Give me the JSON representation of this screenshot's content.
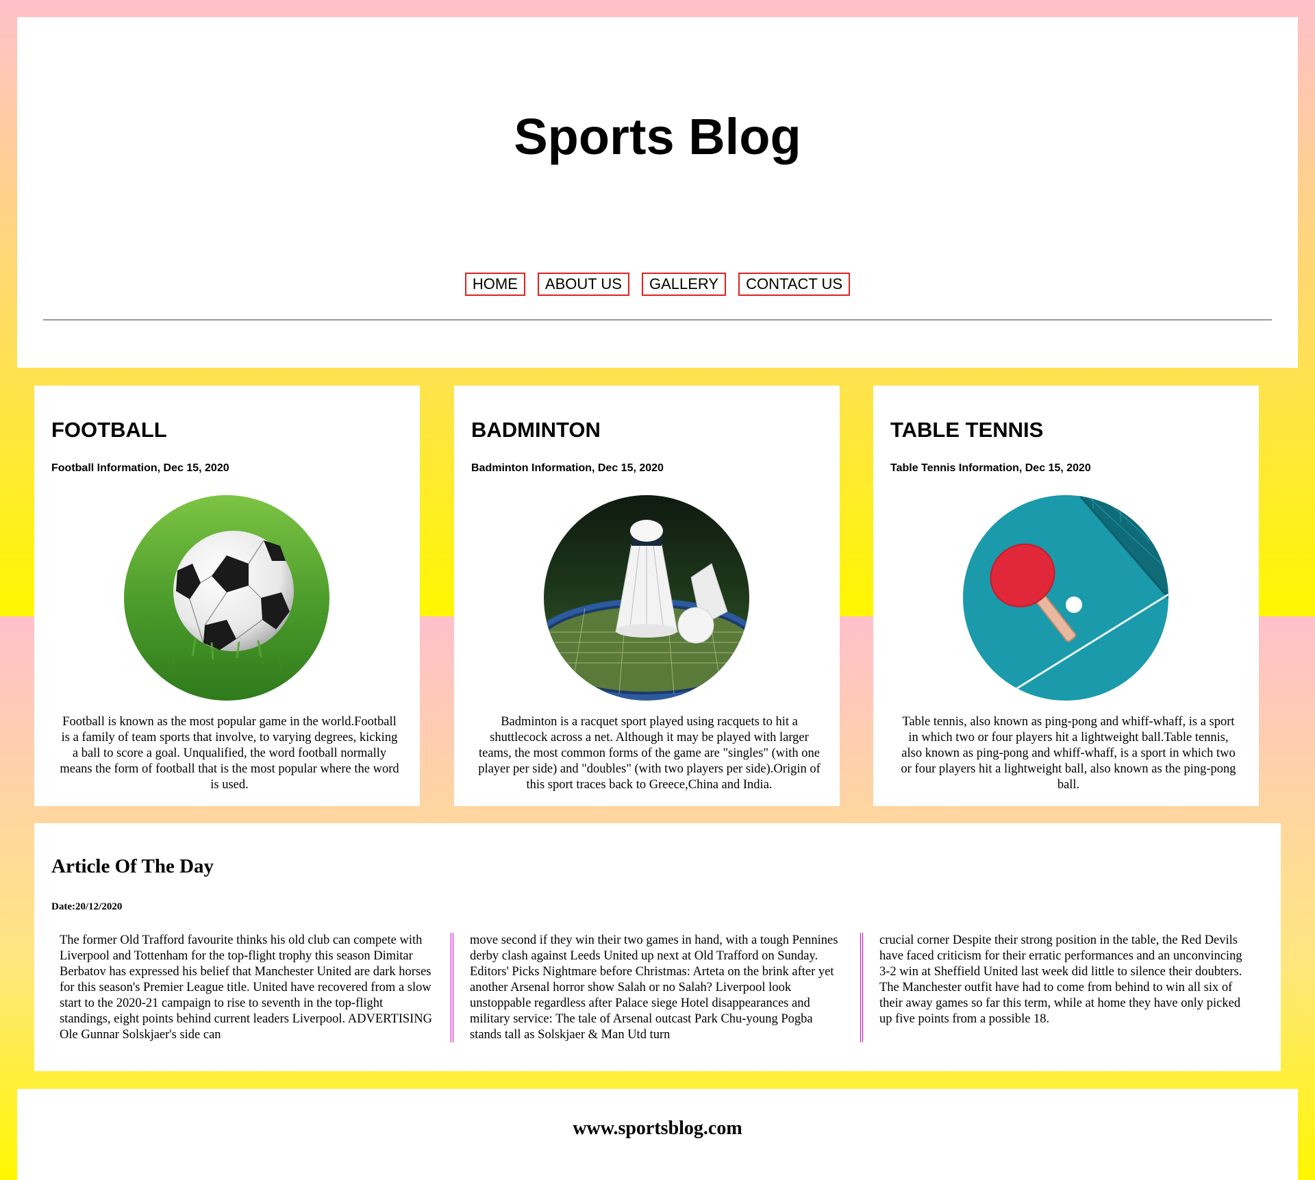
{
  "header": {
    "title": "Sports Blog",
    "nav": [
      "HOME",
      "ABOUT US",
      "GALLERY",
      "CONTACT US"
    ]
  },
  "cards": [
    {
      "title": "FOOTBALL",
      "meta": "Football Information, Dec 15, 2020",
      "image": "soccer-ball-on-grass",
      "text": "Football is known as the most popular game in the world.Football is a family of team sports that involve, to varying degrees, kicking a ball to score a goal. Unqualified, the word football normally means the form of football that is the most popular where the word is used."
    },
    {
      "title": "BADMINTON",
      "meta": "Badminton Information, Dec 15, 2020",
      "image": "shuttlecocks-on-racquet",
      "text": "Badminton is a racquet sport played using racquets to hit a shuttlecock across a net. Although it may be played with larger teams, the most common forms of the game are \"singles\" (with one player per side) and \"doubles\" (with two players per side).Origin of this sport traces back to Greece,China and India."
    },
    {
      "title": "TABLE TENNIS",
      "meta": "Table Tennis Information, Dec 15, 2020",
      "image": "ping-pong-paddle-on-table",
      "text": "Table tennis, also known as ping-pong and whiff-whaff, is a sport in which two or four players hit a lightweight ball.Table tennis, also known as ping-pong and whiff-whaff, is a sport in which two or four players hit a lightweight ball, also known as the ping-pong ball."
    }
  ],
  "article": {
    "title": "Article Of The Day",
    "date": "Date:20/12/2020",
    "columns": [
      "The former Old Trafford favourite thinks his old club can compete with Liverpool and Tottenham for the top-flight trophy this season Dimitar Berbatov has expressed his belief that Manchester United are dark horses for this season's Premier League title. United have recovered from a slow start to the 2020-21 campaign to rise to seventh in the top-flight standings, eight points behind current leaders Liverpool. ADVERTISING Ole Gunnar Solskjaer's side can",
      "move second if they win their two games in hand, with a tough Pennines derby clash against Leeds United up next at Old Trafford on Sunday. Editors' Picks Nightmare before Christmas: Arteta on the brink after yet another Arsenal horror show Salah or no Salah? Liverpool look unstoppable regardless after Palace siege Hotel disappearances and military service: The tale of Arsenal outcast Park Chu-young Pogba stands tall as Solskjaer & Man Utd turn",
      "crucial corner Despite their strong position in the table, the Red Devils have faced criticism for their erratic performances and an unconvincing 3-2 win at Sheffield United last week did little to silence their doubters. The Manchester outfit have had to come from behind to win all six of their away games so far this term, while at home they have only picked up five points from a possible 18."
    ]
  },
  "footer": {
    "text": "www.sportsblog.com"
  },
  "colors": {
    "nav_border": "#e02020",
    "column_rule": "#cc00cc",
    "background_pink": "#ffc0cb",
    "background_yellow": "#fff700"
  }
}
